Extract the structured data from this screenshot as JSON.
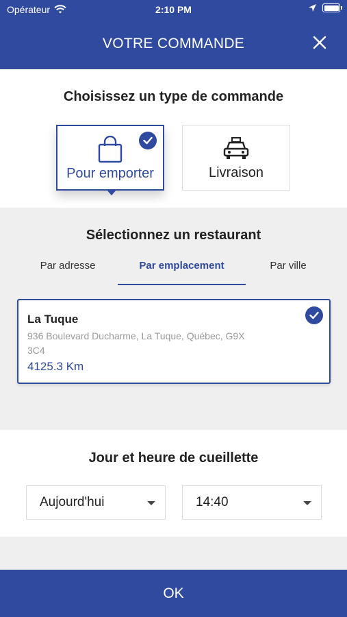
{
  "status_bar": {
    "carrier": "Opérateur",
    "time": "2:10 PM"
  },
  "header": {
    "title": "VOTRE COMMANDE"
  },
  "order_type": {
    "title": "Choisissez un type de commande",
    "options": [
      {
        "label": "Pour emporter",
        "icon": "shopping-bag-icon",
        "selected": true
      },
      {
        "label": "Livraison",
        "icon": "car-icon",
        "selected": false
      }
    ]
  },
  "restaurant": {
    "title": "Sélectionnez un restaurant",
    "tabs": [
      {
        "label": "Par adresse",
        "active": false
      },
      {
        "label": "Par emplacement",
        "active": true
      },
      {
        "label": "Par ville",
        "active": false
      }
    ],
    "selected": {
      "name": "La Tuque",
      "address": "936 Boulevard Ducharme, La Tuque, Québec, G9X 3C4",
      "distance": "4125.3 Km"
    }
  },
  "pickup": {
    "title": "Jour et heure de cueillette",
    "day": "Aujourd'hui",
    "time": "14:40"
  },
  "footer": {
    "ok_label": "OK"
  },
  "colors": {
    "accent": "#2f4a9e",
    "background": "#efefef"
  }
}
